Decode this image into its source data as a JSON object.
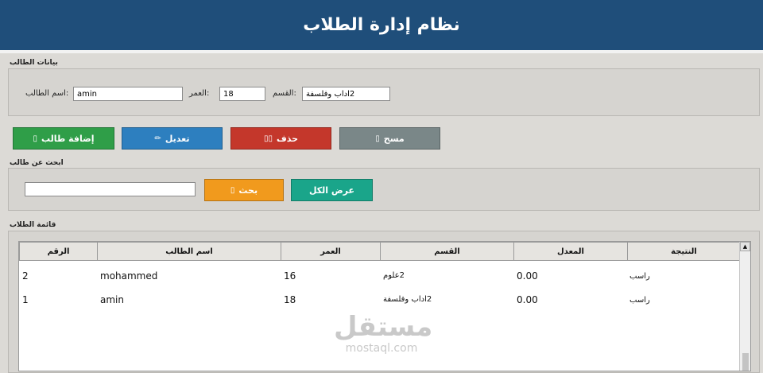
{
  "app": {
    "title": "نظام إدارة الطلاب"
  },
  "student_form": {
    "group_title": "بيانات الطالب",
    "name_label": ":اسم الطالب",
    "name_value": "amin",
    "age_label": ":العمر",
    "age_value": "18",
    "dept_label": ":القسم",
    "dept_value": "2اداب وفلسفة"
  },
  "actions": {
    "add_label": "إضافة طالب",
    "edit_label": "تعديل",
    "delete_label": "حذف",
    "clear_label": "مسح",
    "add_icon": "▯",
    "edit_icon": "✏",
    "delete_icon": "▯▯",
    "clear_icon": "▯",
    "colors": {
      "add": "#2f9e48",
      "edit": "#2d7fbf",
      "delete": "#c4372b",
      "clear": "#7a8788"
    }
  },
  "search": {
    "group_title": "ابحث عن طالب",
    "query": "",
    "search_label": "بحث",
    "search_icon": "▯",
    "show_all_label": "عرض الكل",
    "colors": {
      "search": "#f19a1d",
      "show_all": "#1aa58a"
    }
  },
  "list": {
    "group_title": "قائمة الطلاب",
    "columns": [
      "الرقم",
      "اسم الطالب",
      "العمر",
      "القسم",
      "المعدل",
      "النتيجة"
    ],
    "rows": [
      [
        "2",
        "mohammed",
        "16",
        "2علوم",
        "0.00",
        "راسب"
      ],
      [
        "1",
        "amin",
        "18",
        "2اداب وفلسفة",
        "0.00",
        "راسب"
      ]
    ]
  },
  "watermark": {
    "logo": "مستقل",
    "url": "mostaql.com"
  }
}
